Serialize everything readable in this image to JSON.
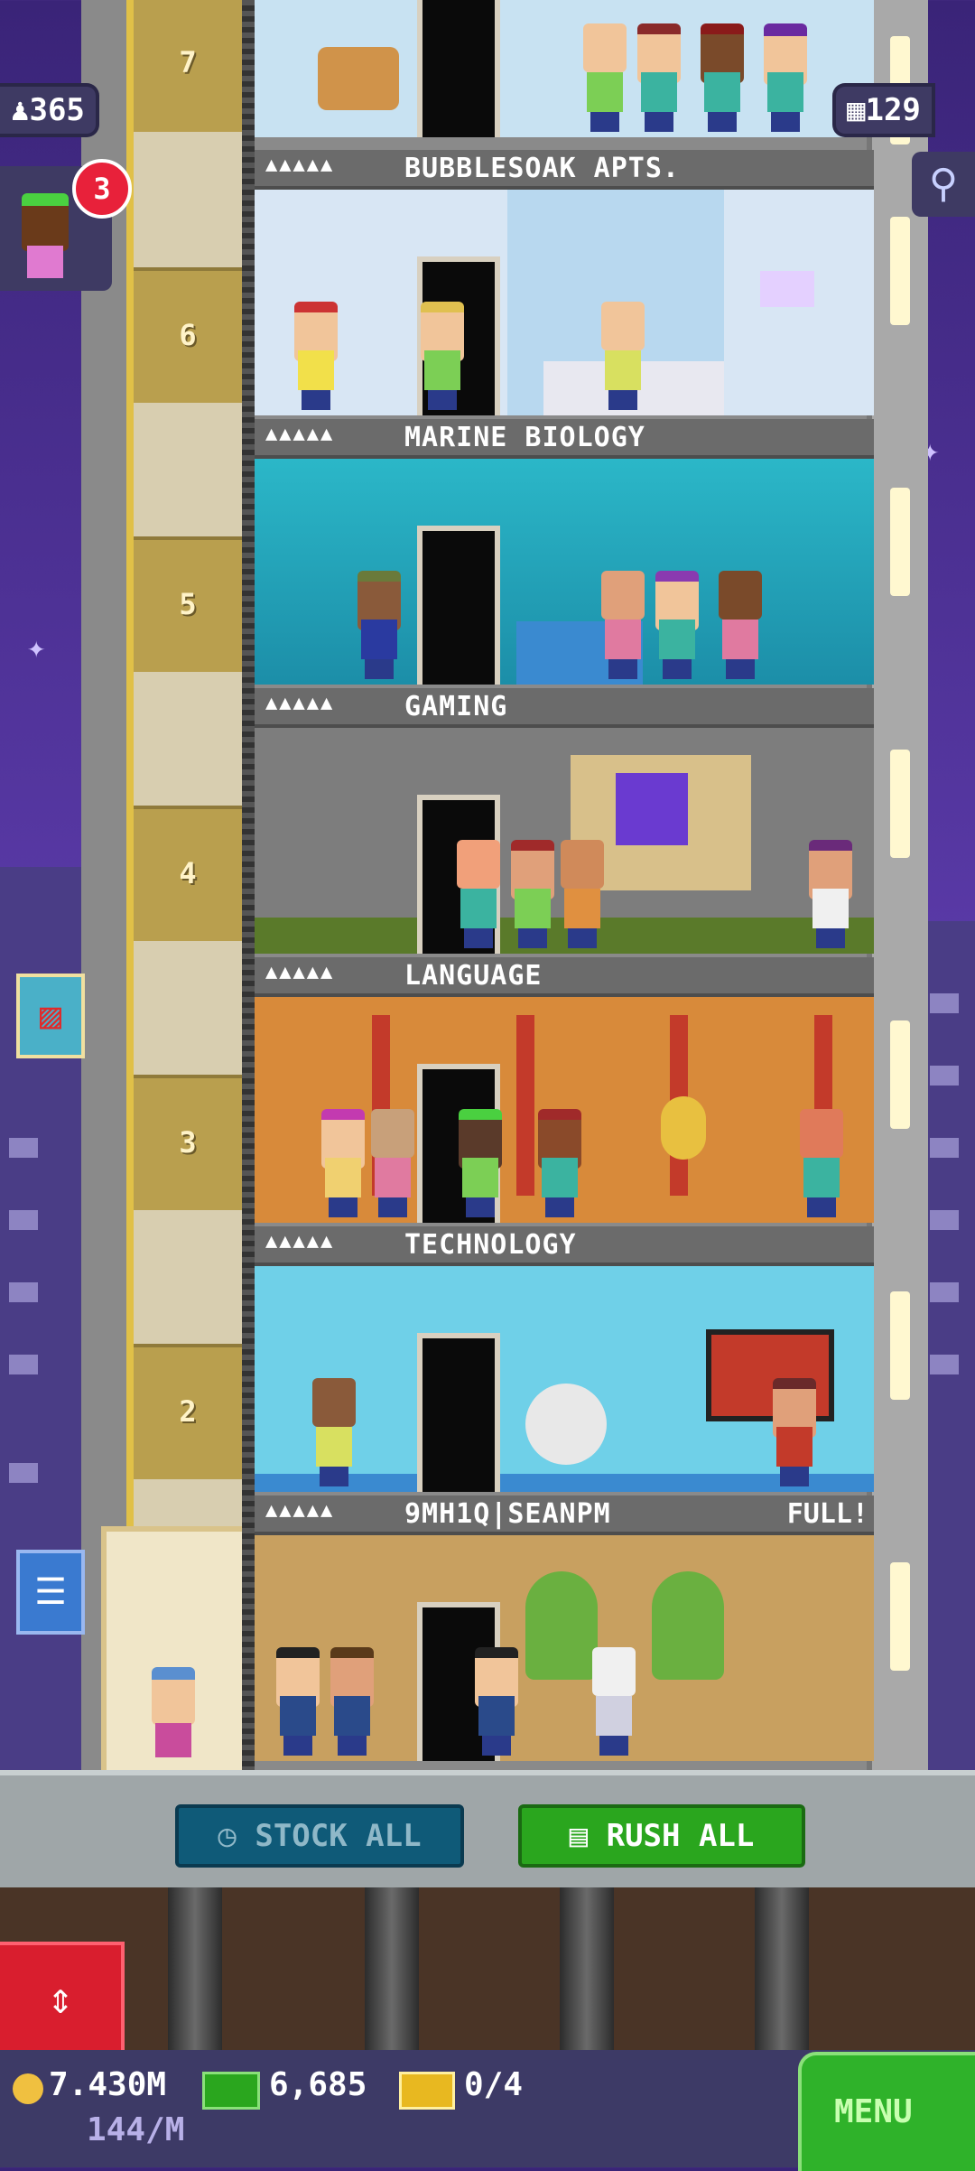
{
  "top_bar": {
    "population": "365",
    "floor_count": "129",
    "notification_count": "3"
  },
  "floors": [
    {
      "number": "6",
      "name": "BUBBLESOAK APTS.",
      "stars": "▲▲▲▲▲",
      "status": ""
    },
    {
      "number": "5",
      "name": "MARINE BIOLOGY",
      "stars": "▲▲▲▲▲",
      "status": ""
    },
    {
      "number": "4",
      "name": "GAMING",
      "stars": "▲▲▲▲▲",
      "status": ""
    },
    {
      "number": "3",
      "name": "LANGUAGE",
      "stars": "▲▲▲▲▲",
      "status": ""
    },
    {
      "number": "2",
      "name": "TECHNOLOGY",
      "stars": "▲▲▲▲▲",
      "status": ""
    },
    {
      "number": "",
      "name": "9MH1Q|SEANPM",
      "stars": "▲▲▲▲▲",
      "status": "FULL!"
    }
  ],
  "top_floor_number": "7",
  "actions": {
    "stock_all": "STOCK ALL",
    "rush_all": "RUSH ALL"
  },
  "currency": {
    "coins": "7.430M",
    "coin_rate": "144/M",
    "bux": "6,685",
    "tickets": "0/4"
  },
  "menu": {
    "label": "MENU"
  },
  "colors": {
    "sky": "#4b2f92",
    "rush_green": "#2aa61e",
    "stock_teal": "#0f5a78",
    "menu_green": "#2fb22a",
    "elevator_red": "#d91e2e"
  }
}
